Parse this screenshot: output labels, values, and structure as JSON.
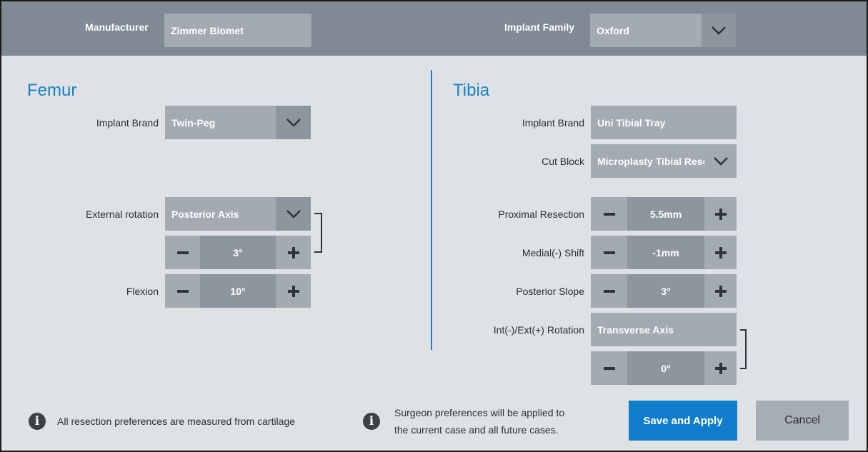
{
  "header": {
    "manufacturer_label": "Manufacturer",
    "manufacturer_value": "Zimmer Biomet",
    "implant_family_label": "Implant Family",
    "implant_family_value": "Oxford"
  },
  "femur": {
    "title": "Femur",
    "implant_brand_label": "Implant Brand",
    "implant_brand_value": "Twin-Peg",
    "external_rotation_label": "External rotation",
    "external_rotation_value": "Posterior Axis",
    "external_rotation_degrees": "3°",
    "flexion_label": "Flexion",
    "flexion_value": "10°"
  },
  "tibia": {
    "title": "Tibia",
    "implant_brand_label": "Implant Brand",
    "implant_brand_value": "Uni Tibial Tray",
    "cut_block_label": "Cut Block",
    "cut_block_value": "Microplasty Tibial Resector",
    "proximal_resection_label": "Proximal Resection",
    "proximal_resection_value": "5.5mm",
    "medial_shift_label": "Medial(-) Shift",
    "medial_shift_value": "-1mm",
    "posterior_slope_label": "Posterior Slope",
    "posterior_slope_value": "3°",
    "rotation_label": "Int(-)/Ext(+) Rotation",
    "rotation_value": "Transverse Axis",
    "rotation_degrees": "0°"
  },
  "footer": {
    "info_cartilage": "All resection preferences are measured from cartilage",
    "info_surgeon_line1": "Surgeon preferences will be applied to",
    "info_surgeon_line2": "the current case and all future cases.",
    "save_label": "Save and Apply",
    "cancel_label": "Cancel"
  },
  "colors": {
    "accent": "#1a7fc7",
    "header_bg": "#7f8a94",
    "primary_button": "#0f7dcb"
  },
  "icons": [
    "chevron-down-icon",
    "minus-icon",
    "plus-icon",
    "info-icon"
  ]
}
